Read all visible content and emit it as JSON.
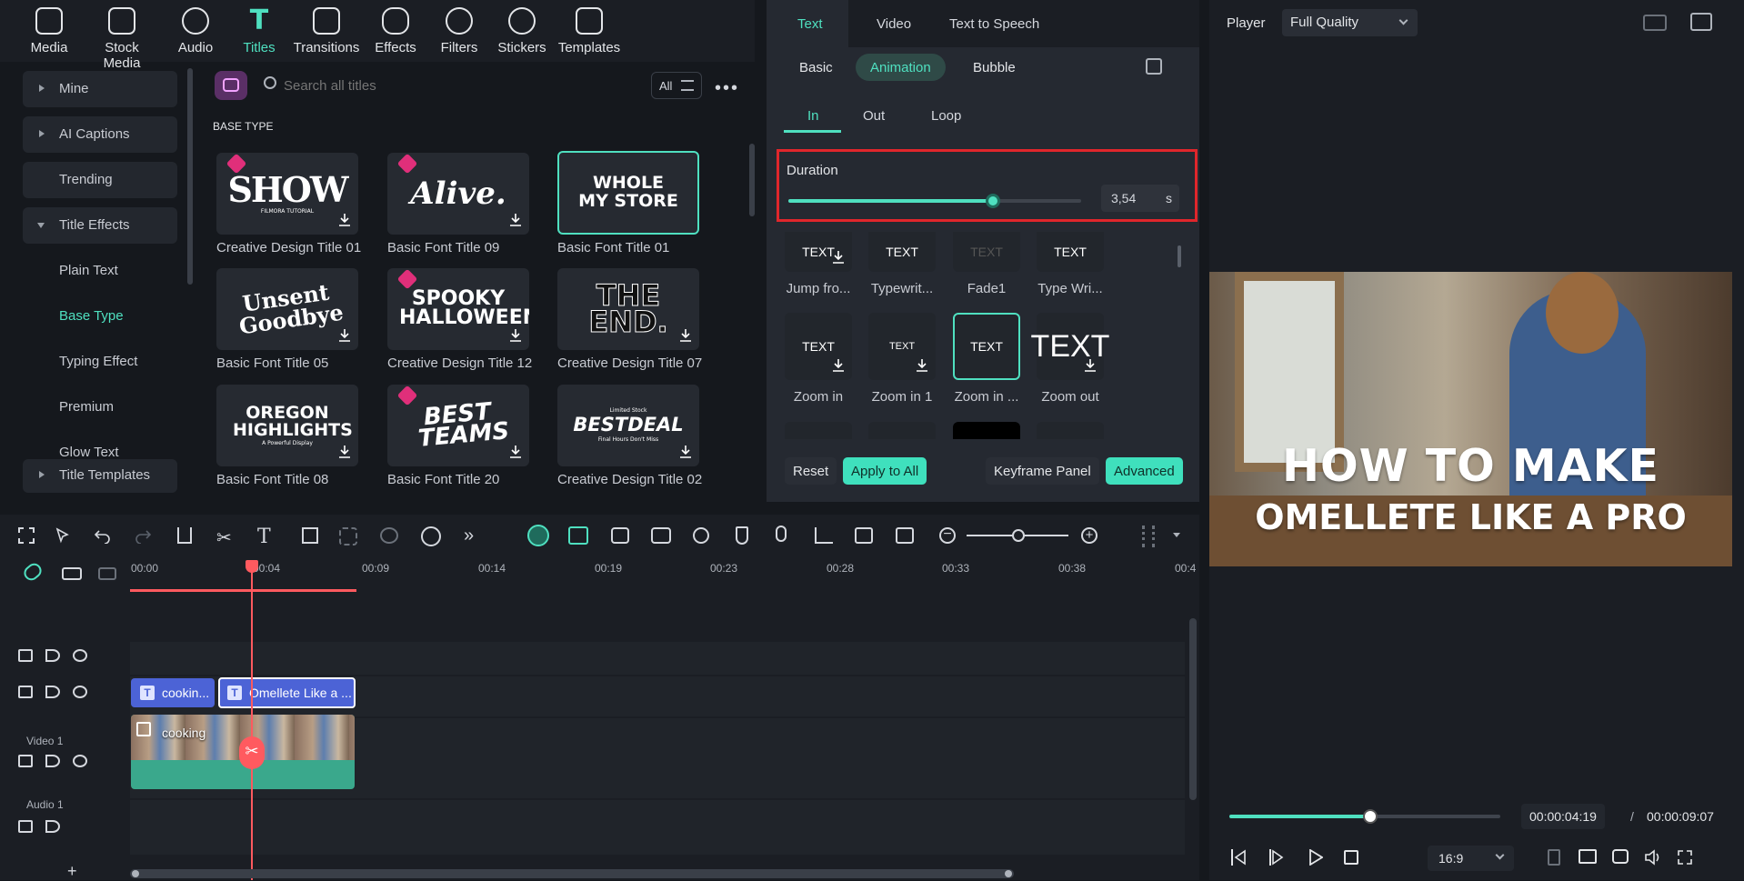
{
  "toolbar": {
    "items": [
      {
        "label": "Media",
        "icon": "media-icon"
      },
      {
        "label": "Stock Media",
        "icon": "stock-media-icon"
      },
      {
        "label": "Audio",
        "icon": "audio-icon"
      },
      {
        "label": "Titles",
        "icon": "titles-icon"
      },
      {
        "label": "Transitions",
        "icon": "transitions-icon"
      },
      {
        "label": "Effects",
        "icon": "effects-icon"
      },
      {
        "label": "Filters",
        "icon": "filters-icon"
      },
      {
        "label": "Stickers",
        "icon": "stickers-icon"
      },
      {
        "label": "Templates",
        "icon": "templates-icon"
      }
    ],
    "active": "Titles"
  },
  "sidebar": {
    "items": [
      "Mine",
      "AI Captions",
      "Trending",
      "Title Effects",
      "Plain Text",
      "Base Type",
      "Typing Effect",
      "Premium",
      "Glow Text",
      "Title Templates"
    ],
    "selected": "Base Type"
  },
  "search": {
    "placeholder": "Search all titles",
    "filter_label": "All"
  },
  "section_title": "BASE TYPE",
  "titles": [
    {
      "name": "Creative Design Title 01",
      "art": "SHOW",
      "sub": "FILMORA TUTORIAL",
      "premium": true
    },
    {
      "name": "Basic Font Title 09",
      "art": "Alive.",
      "premium": true
    },
    {
      "name": "Basic Font Title 01",
      "art": "WHOLE MY STORE",
      "premium": false
    },
    {
      "name": "Basic Font Title 05",
      "art": "Unsent Goodbye",
      "premium": false
    },
    {
      "name": "Creative Design Title 12",
      "art": "SPOOKY HALLOWEEN",
      "premium": true
    },
    {
      "name": "Creative Design Title 07",
      "art": "THE END.",
      "premium": false
    },
    {
      "name": "Basic Font Title 08",
      "art": "OREGON HIGHLIGHTS",
      "sub": "A Powerful Display",
      "premium": false
    },
    {
      "name": "Basic Font Title 20",
      "art": "BEST TEAMS",
      "premium": true
    },
    {
      "name": "Creative Design Title 02",
      "art": "BESTDEAL",
      "sub": "Limited Stock",
      "sub2": "Final Hours Don't Miss",
      "premium": false
    }
  ],
  "panel": {
    "tabs": [
      "Text",
      "Video",
      "Text to Speech"
    ],
    "subtabs": [
      "Basic",
      "Animation",
      "Bubble"
    ],
    "inout": [
      "In",
      "Out",
      "Loop"
    ],
    "duration_label": "Duration",
    "duration_value": "3,54",
    "duration_unit": "s",
    "duration_fraction": 0.7,
    "animations": [
      {
        "name": "Jump fro...",
        "art": "TEXT"
      },
      {
        "name": "Typewrit...",
        "art": "TEXT"
      },
      {
        "name": "Fade1",
        "art": "TEXT"
      },
      {
        "name": "Type Wri...",
        "art": "TEXT"
      },
      {
        "name": "Zoom in",
        "art": "TEXT"
      },
      {
        "name": "Zoom in 1",
        "art": "TEXT"
      },
      {
        "name": "Zoom in ...",
        "art": "TEXT"
      },
      {
        "name": "Zoom out",
        "art": "TEXT"
      }
    ],
    "buttons": {
      "reset": "Reset",
      "apply_all": "Apply to All",
      "keyframe": "Keyframe Panel",
      "advanced": "Advanced"
    }
  },
  "player": {
    "label": "Player",
    "quality": "Full Quality",
    "overlay_line1": "HOW TO MAKE",
    "overlay_line2": "OMELLETE LIKE A PRO",
    "current_time": "00:00:04:19",
    "separator": "/",
    "total_time": "00:00:09:07",
    "progress": 0.52,
    "ratio": "16:9"
  },
  "timeline": {
    "ticks": [
      "00:00",
      "00:04",
      "00:09",
      "00:14",
      "00:19",
      "00:23",
      "00:28",
      "00:33",
      "00:38",
      "00:4"
    ],
    "clips": {
      "title1": "cookin...",
      "title2": "Omellete Like a ...",
      "video": "cooking"
    },
    "tracks": {
      "video": "Video 1",
      "audio": "Audio 1"
    },
    "add": "+"
  },
  "colors": {
    "accent": "#4fe0c0",
    "highlight_box": "#e0262b",
    "playhead": "#ff5a5f",
    "title_clip": "#4c63d6",
    "video_clip": "#3aa88c"
  }
}
